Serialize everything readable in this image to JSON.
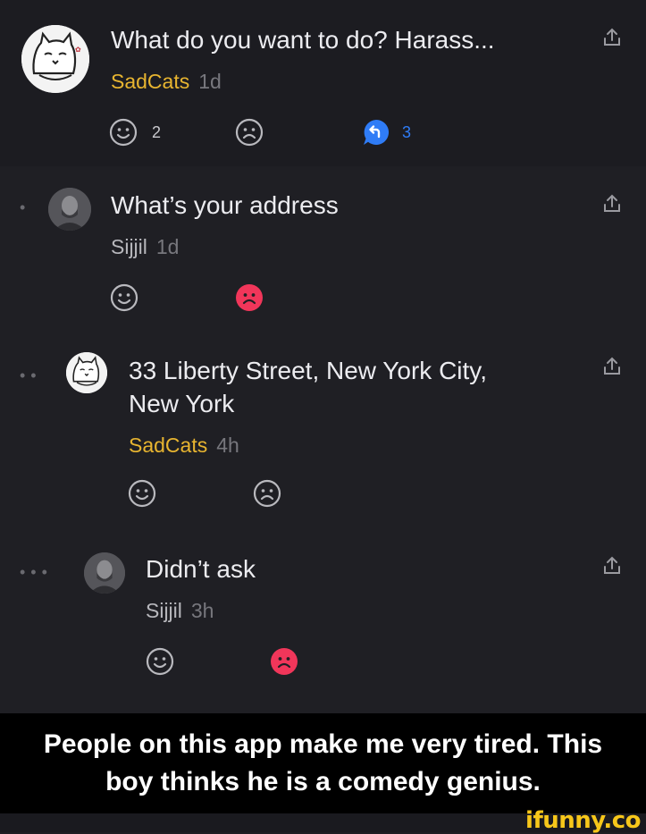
{
  "comments": [
    {
      "text": "What do you want to do? Harass...",
      "author": "SadCats",
      "time": "1d",
      "like_count": "2",
      "reply_count": "3"
    },
    {
      "text": "What’s your address",
      "author": "Sijjil",
      "time": "1d"
    },
    {
      "text_line1": "33 Liberty Street, New York City,",
      "text_line2": "New York",
      "author": "SadCats",
      "time": "4h"
    },
    {
      "text": "Didn’t ask",
      "author": "Sijjil",
      "time": "3h"
    }
  ],
  "caption": {
    "line1": "People on this app make me very tired. This",
    "line2": "boy thinks he is a comedy genius."
  },
  "watermark": "ifunny.co",
  "colors": {
    "background": "#1f1f24",
    "author_gold": "#e8b530",
    "dislike_active": "#f1365a",
    "reply_blue": "#2f7cf6"
  }
}
